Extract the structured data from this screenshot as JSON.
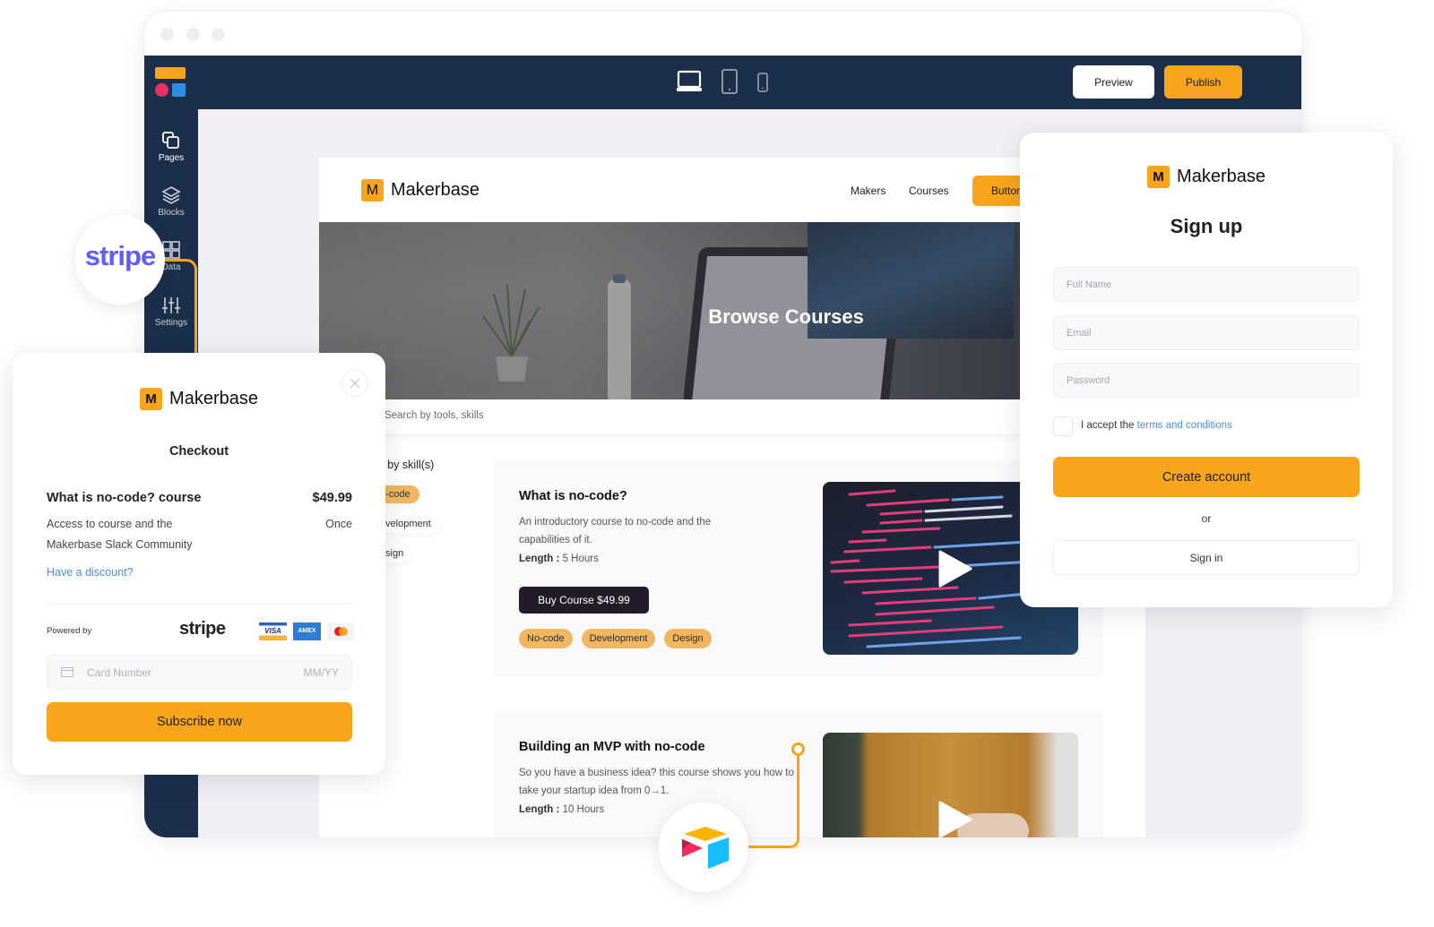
{
  "editor": {
    "window_dots": [
      "close",
      "minimize",
      "maximize"
    ],
    "device_icons": [
      {
        "name": "desktop",
        "active": true
      },
      {
        "name": "tablet",
        "active": false
      },
      {
        "name": "mobile",
        "active": false
      }
    ],
    "preview_label": "Preview",
    "publish_label": "Publish",
    "colors": {
      "navy": "#1c2f4a",
      "accent": "#f8a51b",
      "canvas": "#efeff4"
    },
    "sidebar": [
      {
        "label": "Pages",
        "icon": "pages-icon"
      },
      {
        "label": "Blocks",
        "icon": "layers-icon"
      },
      {
        "label": "Data",
        "icon": "grid-icon"
      },
      {
        "label": "Settings",
        "icon": "sliders-icon"
      }
    ]
  },
  "site": {
    "brand_letter": "M",
    "brand_name": "Makerbase",
    "nav": [
      "Makers",
      "Courses"
    ],
    "nav_button": "Button",
    "hero_title": "Browse Courses",
    "search_placeholder": "Search by tools, skills",
    "filter_title": "Filter by skill(s)",
    "filters": [
      {
        "label": "No-code",
        "active": true
      },
      {
        "label": "Development",
        "active": false
      },
      {
        "label": "Design",
        "active": false
      }
    ],
    "courses": [
      {
        "title": "What is no-code?",
        "description": "An introductory course to no-code and the capabilities of it.",
        "length_label": "Length :",
        "length_value": "5 Hours",
        "buy_label": "Buy Course $49.99",
        "tags": [
          "No-code",
          "Development",
          "Design"
        ]
      },
      {
        "title": "Building an MVP with no-code",
        "description": "So you have a business idea? this course shows you how to take your startup idea from 0→1.",
        "length_label": "Length :",
        "length_value": "10 Hours"
      }
    ]
  },
  "checkout": {
    "brand_letter": "M",
    "brand_name": "Makerbase",
    "title": "Checkout",
    "item_name": "What is no-code? course",
    "item_price": "$49.99",
    "item_desc_line1": "Access to course and the",
    "item_desc_line2": "Makerbase Slack Community",
    "billing": "Once",
    "discount_link": "Have a discount?",
    "powered_by": "Powered by",
    "stripe_word": "stripe",
    "cards": [
      "VISA",
      "AMEX",
      "Mastercard"
    ],
    "card_placeholder": "Card Number",
    "expiry_placeholder": "MM/YY",
    "submit_label": "Subscribe now"
  },
  "signup": {
    "brand_letter": "M",
    "brand_name": "Makerbase",
    "title": "Sign up",
    "fields": [
      {
        "placeholder": "Full Name"
      },
      {
        "placeholder": "Email"
      },
      {
        "placeholder": "Password"
      }
    ],
    "terms_prefix": "I accept the",
    "terms_link": "terms and conditions",
    "create_label": "Create account",
    "or_label": "or",
    "signin_label": "Sign in"
  },
  "integrations": {
    "stripe_badge": "stripe",
    "airtable_badge": "airtable"
  }
}
